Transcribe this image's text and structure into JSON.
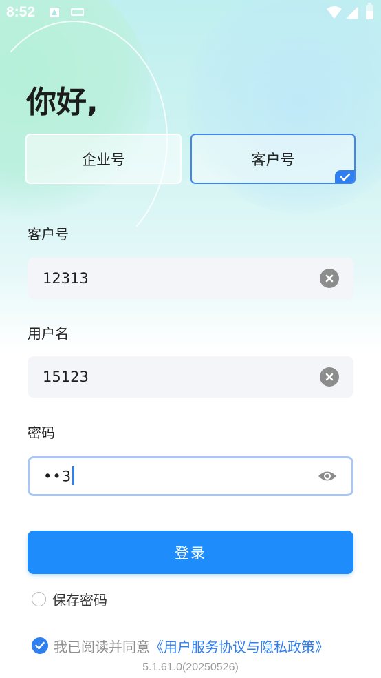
{
  "status_bar": {
    "time": "8:52"
  },
  "greeting": "你好,",
  "account_types": {
    "enterprise_label": "企业号",
    "customer_label": "客户号",
    "selected": "customer"
  },
  "form": {
    "customer_no": {
      "label": "客户号",
      "value": "12313"
    },
    "username": {
      "label": "用户名",
      "value": "15123"
    },
    "password": {
      "label": "密码",
      "masked_value": "••3"
    }
  },
  "login_button": "登录",
  "save_password": {
    "label": "保存密码",
    "checked": false
  },
  "agreement": {
    "text": "我已阅读并同意",
    "link": "《用户服务协议与隐私政策》",
    "checked": true
  },
  "version": "5.1.61.0(20250526)",
  "colors": {
    "accent": "#1e8cfa",
    "link": "#2f7ff0",
    "input_bg": "#f4f5f9"
  }
}
